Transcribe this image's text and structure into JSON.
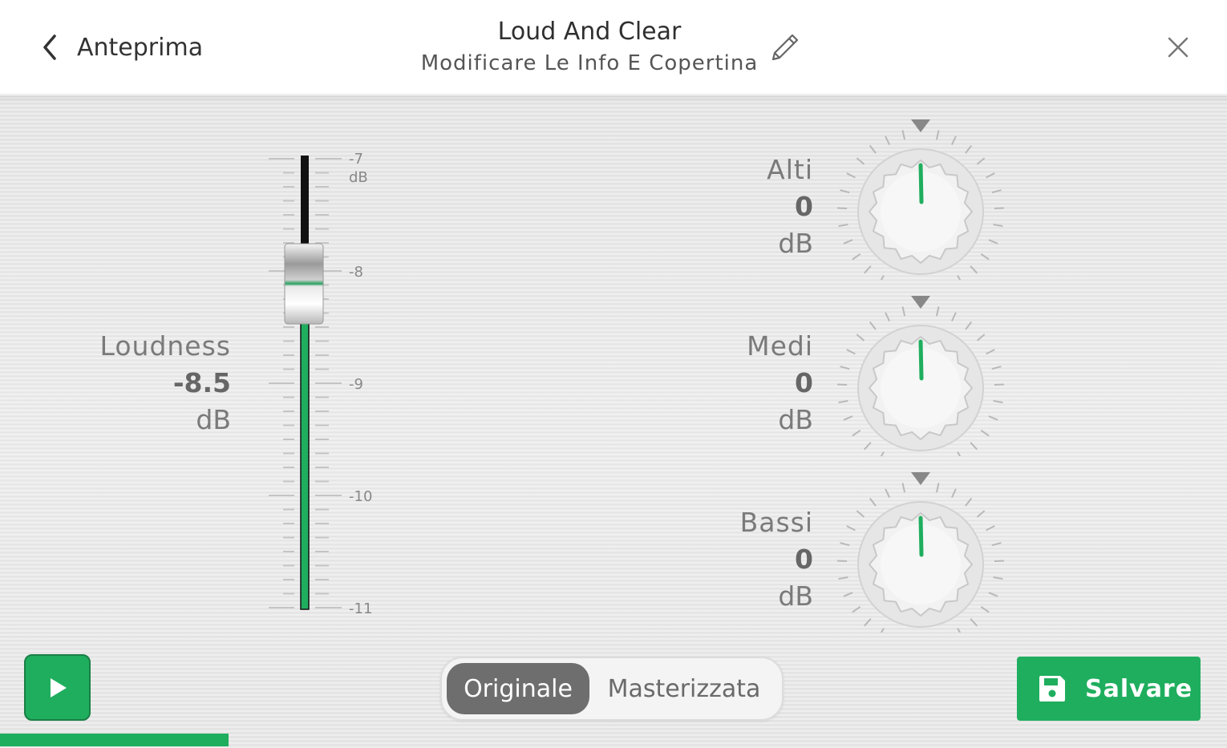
{
  "header": {
    "back_label": "Anteprima",
    "title": "Loud And Clear",
    "subtitle": "Modificare Le Info E Copertina"
  },
  "loudness": {
    "label": "Loudness",
    "value": "-8.5",
    "unit": "dB",
    "scale_labels": [
      "-7",
      "-8",
      "-9",
      "-10",
      "-11"
    ],
    "scale_unit": "dB",
    "scale_min": -11,
    "scale_max": -7,
    "current": -8.5
  },
  "knobs": [
    {
      "name": "Alti",
      "value": "0",
      "unit": "dB"
    },
    {
      "name": "Medi",
      "value": "0",
      "unit": "dB"
    },
    {
      "name": "Bassi",
      "value": "0",
      "unit": "dB"
    }
  ],
  "toggle": {
    "original_label": "Originale",
    "mastered_label": "Masterizzata",
    "selected": "Originale"
  },
  "save_label": "Salvare",
  "playback_progress": 0.186,
  "colors": {
    "accent": "#1fae5e",
    "selected_toggle": "#6e6e6e"
  },
  "icons": {
    "back": "chevron-left-icon",
    "edit": "pencil-icon",
    "close": "close-icon",
    "play": "play-icon",
    "save": "floppy-disk-icon"
  }
}
